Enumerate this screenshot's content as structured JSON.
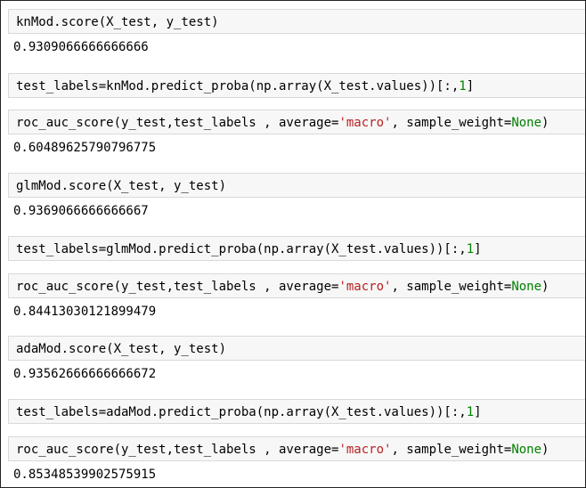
{
  "cells": [
    {
      "code": "knMod.score(X_test, y_test)",
      "output": "0.9309066666666666"
    },
    {
      "code_prefix": "test_labels=knMod.predict_proba(np.array(X_test.values))[:,",
      "code_num": "1",
      "code_suffix": "]"
    },
    {
      "code_prefix": "roc_auc_score(y_test,test_labels , average=",
      "code_str": "'macro'",
      "code_mid": ", sample_weight=",
      "code_kw": "None",
      "code_suffix": ")",
      "output": "0.60489625790796775"
    },
    {
      "code": "glmMod.score(X_test, y_test)",
      "output": "0.9369066666666667"
    },
    {
      "code_prefix": "test_labels=glmMod.predict_proba(np.array(X_test.values))[:,",
      "code_num": "1",
      "code_suffix": "]"
    },
    {
      "code_prefix": "roc_auc_score(y_test,test_labels , average=",
      "code_str": "'macro'",
      "code_mid": ", sample_weight=",
      "code_kw": "None",
      "code_suffix": ")",
      "output": "0.84413030121899479"
    },
    {
      "code": "adaMod.score(X_test, y_test)",
      "output": "0.93562666666666672"
    },
    {
      "code_prefix": "test_labels=adaMod.predict_proba(np.array(X_test.values))[:,",
      "code_num": "1",
      "code_suffix": "]"
    },
    {
      "code_prefix": "roc_auc_score(y_test,test_labels , average=",
      "code_str": "'macro'",
      "code_mid": ", sample_weight=",
      "code_kw": "None",
      "code_suffix": ")",
      "output": "0.85348539902575915"
    }
  ]
}
